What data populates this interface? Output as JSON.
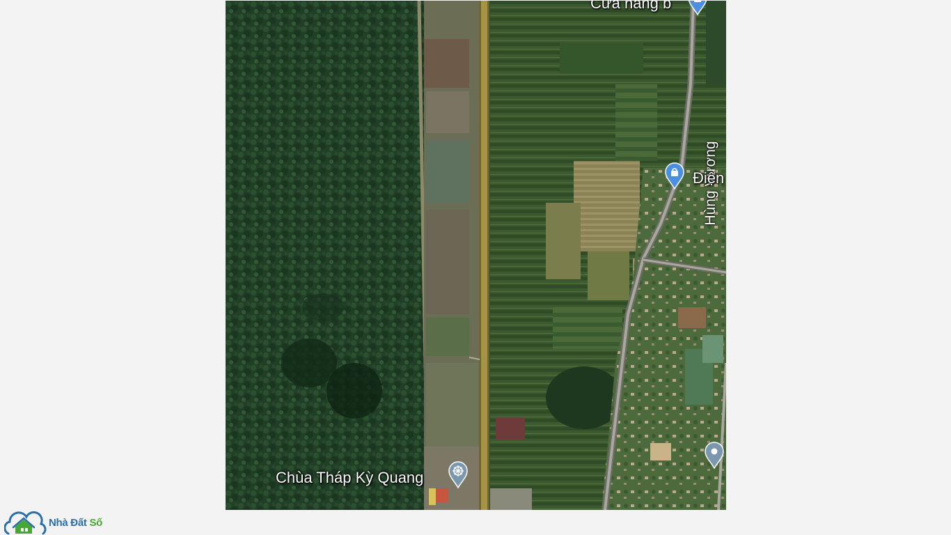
{
  "map": {
    "road_label": "Hùng Vương",
    "labels": {
      "store": "Cửa hàng b",
      "dien": "Điện",
      "pagoda": "Chùa Tháp Kỳ Quang"
    },
    "pins": {
      "store": "shopping-bag-icon",
      "dien": "shopping-bag-icon",
      "pagoda": "dharma-wheel-icon",
      "generic": "location-pin-icon"
    }
  },
  "logo": {
    "part1": "Nhà Đất ",
    "part2": "Số"
  },
  "colors": {
    "forest": "#1f3c24",
    "road": "#8a7a3a",
    "pin_blue": "#4a8fe0",
    "pin_grey": "#7b97ad",
    "logo_blue": "#2b6ea8",
    "logo_green": "#44a832"
  }
}
